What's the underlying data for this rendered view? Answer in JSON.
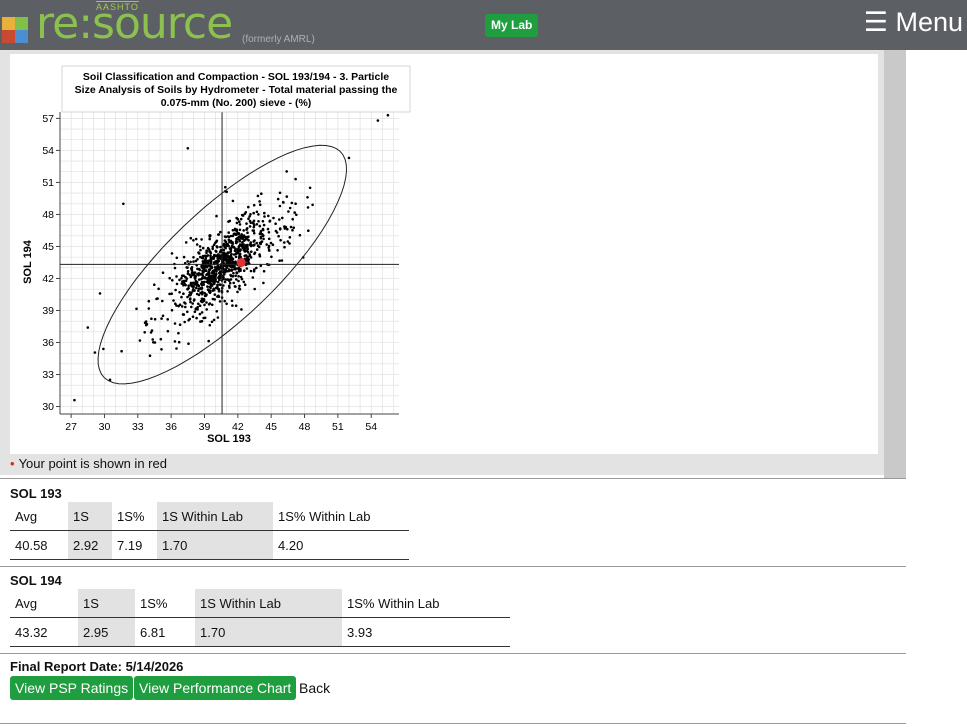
{
  "header": {
    "brand": "re:source",
    "brand_super": "AASHTO",
    "formerly": "(formerly AMRL)",
    "my_lab": "My Lab",
    "menu": "☰ Menu"
  },
  "chart_data": {
    "type": "scatter",
    "title": "Soil Classification and Compaction - SOL 193/194 - 3. Particle Size Analysis of Soils by Hydrometer - Total material passing the 0.075-mm (No. 200) sieve - (%)",
    "title_lines": [
      "Soil Classification and Compaction - SOL 193/194 - 3. Particle",
      "Size Analysis of Soils by Hydrometer - Total material passing the",
      "0.075-mm (No. 200) sieve - (%)"
    ],
    "xlabel": "SOL 193",
    "ylabel": "SOL 194",
    "xlim": [
      26,
      56.5
    ],
    "ylim": [
      29.3,
      57.6
    ],
    "xticks": [
      27,
      30,
      33,
      36,
      39,
      42,
      45,
      48,
      51,
      54
    ],
    "yticks": [
      30,
      33,
      36,
      39,
      42,
      45,
      48,
      51,
      54,
      57
    ],
    "grid": true,
    "mean": {
      "x": 40.58,
      "y": 43.32
    },
    "ellipse": {
      "center": [
        40.6,
        43.3
      ],
      "angle_deg": 45,
      "semi_major": 15.0,
      "semi_minor": 5.0
    },
    "your_point": {
      "x": 42.3,
      "y": 43.5,
      "color": "#dd3333"
    },
    "n_points": 1000,
    "point_color": "#000000",
    "sample_points": [
      [
        27.3,
        30.6
      ],
      [
        29.6,
        40.6
      ],
      [
        29.9,
        35.4
      ],
      [
        31.7,
        49.0
      ],
      [
        37.5,
        54.2
      ],
      [
        52.0,
        53.3
      ],
      [
        54.6,
        56.8
      ],
      [
        55.5,
        57.3
      ],
      [
        28.5,
        37.4
      ],
      [
        30.5,
        32.5
      ]
    ]
  },
  "legend_note": "Your point is shown in red",
  "sol193": {
    "title": "SOL 193",
    "headers": [
      "Avg",
      "1S",
      "1S%",
      "1S Within Lab",
      "1S% Within Lab"
    ],
    "values": [
      "40.58",
      "2.92",
      "7.19",
      "1.70",
      "4.20"
    ]
  },
  "sol194": {
    "title": "SOL 194",
    "headers": [
      "Avg",
      "1S",
      "1S%",
      "1S Within Lab",
      "1S% Within Lab"
    ],
    "values": [
      "43.32",
      "2.95",
      "6.81",
      "1.70",
      "3.93"
    ]
  },
  "footer": {
    "report_date": "Final Report Date: 5/14/2026",
    "psp_button": "View PSP Ratings",
    "perf_button": "View Performance Chart",
    "back": "Back"
  },
  "colors": {
    "header_bg": "#5c5f63",
    "brand_green": "#8cc14f",
    "button_green": "#1e9e3e"
  }
}
